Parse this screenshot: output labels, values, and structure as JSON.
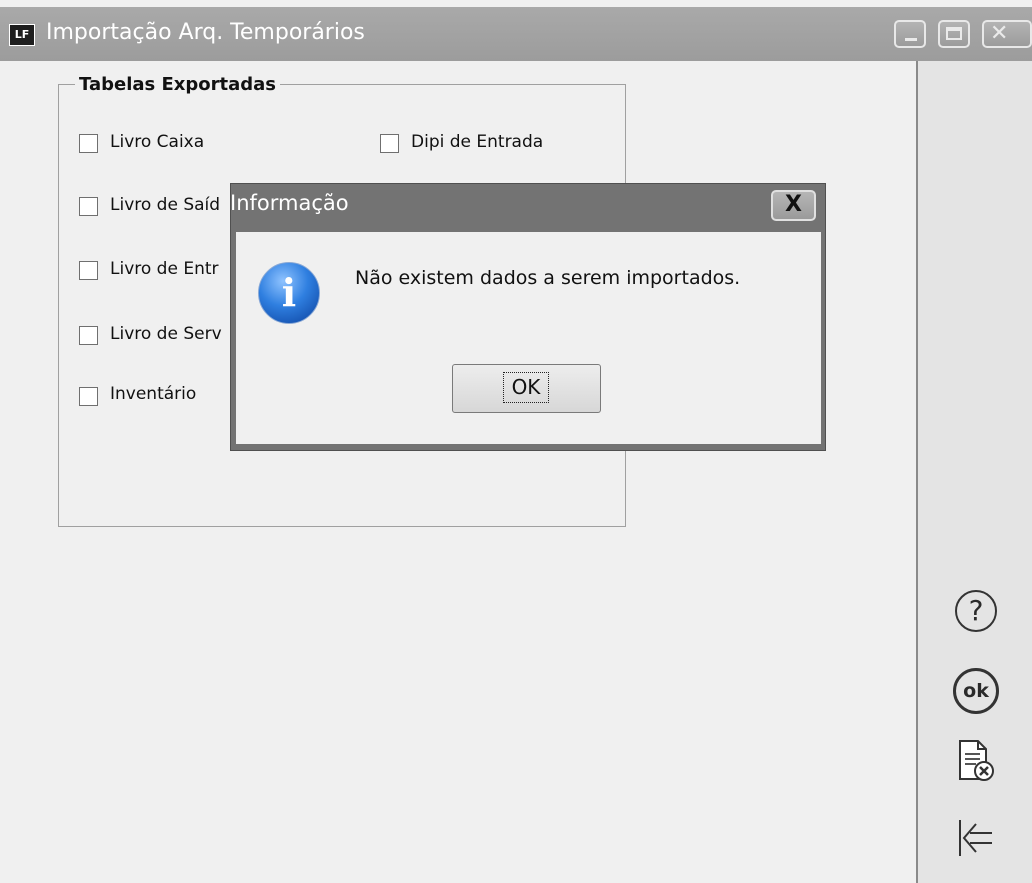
{
  "window": {
    "icon_text": "LF",
    "title": "Importação Arq. Temporários"
  },
  "groupbox": {
    "legend": "Tabelas Exportadas",
    "checkboxes": [
      {
        "label": "Livro Caixa",
        "checked": false
      },
      {
        "label": "Dipi de Entrada",
        "checked": false
      },
      {
        "label": "Livro de Saíd",
        "checked": false
      },
      {
        "label": "Livro de Entr",
        "checked": false
      },
      {
        "label": "Livro de Serv",
        "checked": false
      },
      {
        "label": "Inventário",
        "checked": false
      }
    ]
  },
  "dialog": {
    "title": "Informação",
    "close_label": "X",
    "icon": "info-icon",
    "icon_glyph": "i",
    "message": "Não existem dados a serem importados.",
    "ok_label": "OK"
  },
  "side_panel": {
    "icons": [
      "help-icon",
      "ok-circle-icon",
      "document-cancel-icon",
      "exit-icon"
    ],
    "help_glyph": "?",
    "ok_glyph": "ok"
  }
}
